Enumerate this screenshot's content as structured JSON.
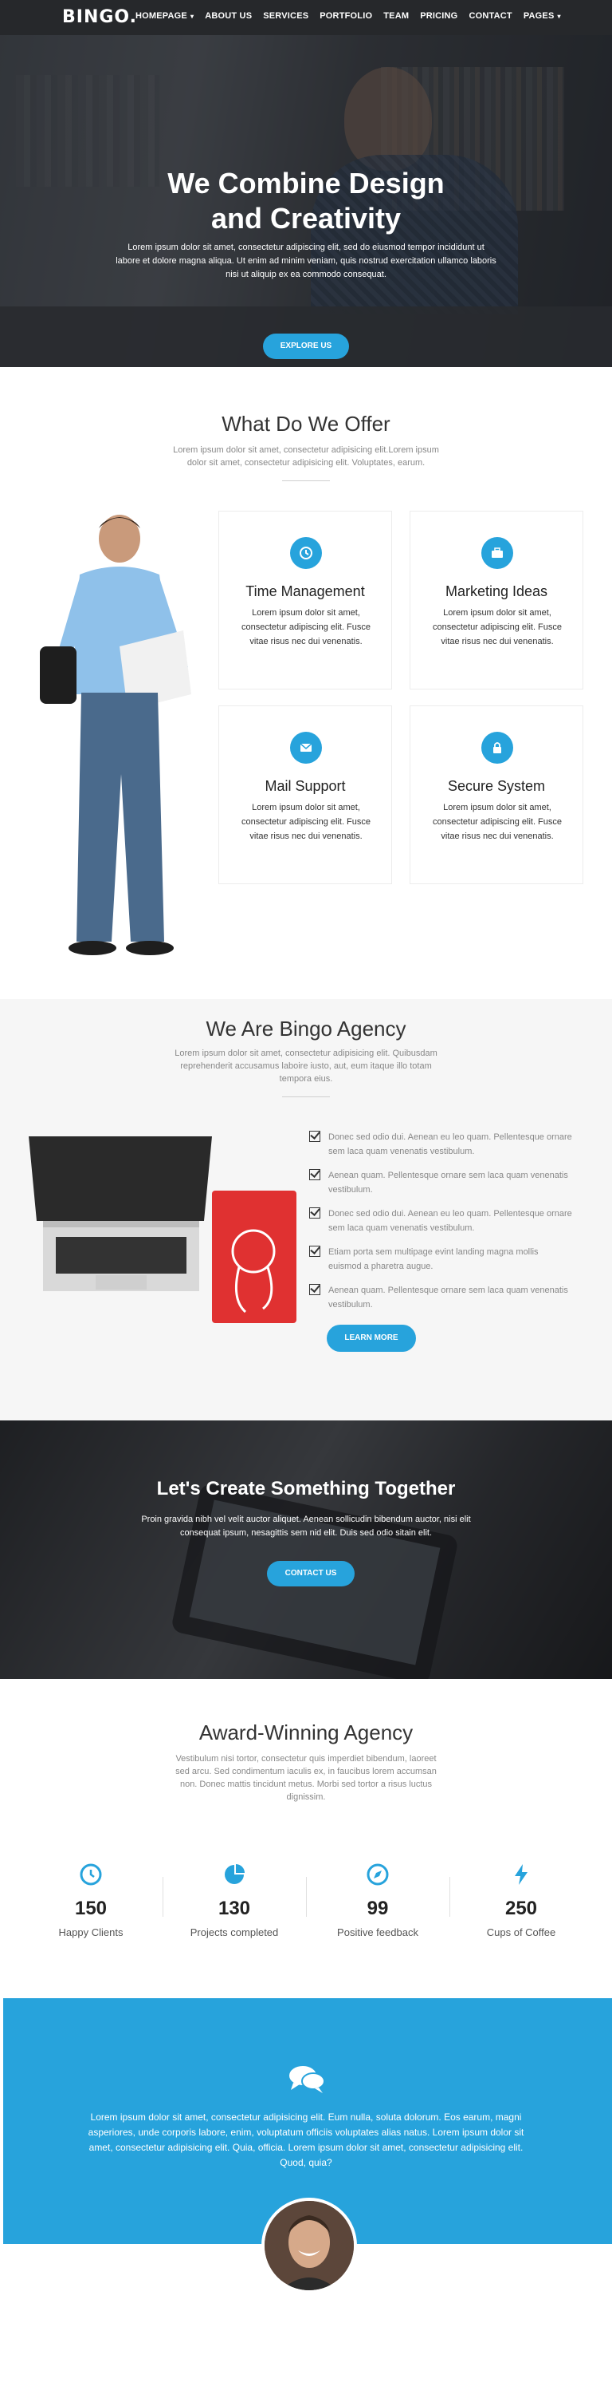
{
  "brand": "BINGO.",
  "nav": [
    {
      "label": "HOMEPAGE",
      "caret": "▾"
    },
    {
      "label": "ABOUT US",
      "caret": ""
    },
    {
      "label": "SERVICES",
      "caret": ""
    },
    {
      "label": "PORTFOLIO",
      "caret": ""
    },
    {
      "label": "TEAM",
      "caret": ""
    },
    {
      "label": "PRICING",
      "caret": ""
    },
    {
      "label": "CONTACT",
      "caret": ""
    },
    {
      "label": "PAGES",
      "caret": "▾"
    }
  ],
  "hero": {
    "title_line1": "We Combine Design",
    "title_line2": "and Creativity",
    "text": "Lorem ipsum dolor sit amet, consectetur adipiscing elit, sed do eiusmod tempor incididunt ut labore et dolore magna aliqua. Ut enim ad minim veniam, quis nostrud exercitation ullamco laboris nisi ut aliquip ex ea commodo consequat.",
    "button": "EXPLORE US"
  },
  "offer": {
    "title": "What Do We Offer",
    "subtitle": "Lorem ipsum dolor sit amet, consectetur adipisicing elit.Lorem ipsum dolor sit amet, consectetur adipisicing elit. Voluptates, earum.",
    "cards": [
      {
        "icon": "clock-icon",
        "title": "Time Management",
        "text": "Lorem ipsum dolor sit amet, consectetur adipiscing elit. Fusce vitae risus nec dui venenatis."
      },
      {
        "icon": "briefcase-icon",
        "title": "Marketing Ideas",
        "text": "Lorem ipsum dolor sit amet, consectetur adipiscing elit. Fusce vitae risus nec dui venenatis."
      },
      {
        "icon": "envelope-icon",
        "title": "Mail Support",
        "text": "Lorem ipsum dolor sit amet, consectetur adipiscing elit. Fusce vitae risus nec dui venenatis."
      },
      {
        "icon": "lock-icon",
        "title": "Secure System",
        "text": "Lorem ipsum dolor sit amet, consectetur adipiscing elit. Fusce vitae risus nec dui venenatis."
      }
    ]
  },
  "agency": {
    "title": "We Are Bingo Agency",
    "subtitle": "Lorem ipsum dolor sit amet, consectetur adipisicing elit. Quibusdam reprehenderit accusamus laboire iusto, aut, eum itaque illo totam tempora eius.",
    "checklist": [
      "Donec sed odio dui. Aenean eu leo quam. Pellentesque ornare sem laca quam venenatis vestibulum.",
      "Aenean quam. Pellentesque ornare sem laca quam venenatis vestibulum.",
      "Donec sed odio dui. Aenean eu leo quam. Pellentesque ornare sem laca quam venenatis vestibulum.",
      "Etiam porta sem multipage evint landing magna mollis euismod a pharetra augue.",
      "Aenean quam. Pellentesque ornare sem laca quam venenatis vestibulum."
    ],
    "button": "LEARN MORE"
  },
  "cta": {
    "title": "Let's Create Something Together",
    "text": "Proin gravida nibh vel velit auctor aliquet. Aenean sollicudin bibendum auctor, nisi elit consequat ipsum, nesagittis sem nid elit. Duis sed odio sitain elit.",
    "button": "CONTACT US"
  },
  "awards": {
    "title": "Award-Winning Agency",
    "subtitle": "Vestibulum nisi tortor, consectetur quis imperdiet bibendum, laoreet sed arcu. Sed condimentum iaculis ex, in faucibus lorem accumsan non. Donec mattis tincidunt metus. Morbi sed tortor a risus luctus dignissim.",
    "stats": [
      {
        "icon": "clock-icon",
        "value": "150",
        "label": "Happy Clients"
      },
      {
        "icon": "pie-chart-icon",
        "value": "130",
        "label": "Projects completed"
      },
      {
        "icon": "compass-icon",
        "value": "99",
        "label": "Positive feedback"
      },
      {
        "icon": "bolt-icon",
        "value": "250",
        "label": "Cups of Coffee"
      }
    ]
  },
  "testimonial": {
    "icon": "comments-icon",
    "text": "Lorem ipsum dolor sit amet, consectetur adipisicing elit. Eum nulla, soluta dolorum. Eos earum, magni asperiores, unde corporis labore, enim, voluptatum officiis voluptates alias natus. Lorem ipsum dolor sit amet, consectetur adipisicing elit. Quia, officia. Lorem ipsum dolor sit amet, consectetur adipisicing elit. Quod, quia?"
  },
  "colors": {
    "accent": "#27a3dc",
    "nav_bg": "#26282b",
    "agency_bg": "#f6f6f6"
  }
}
